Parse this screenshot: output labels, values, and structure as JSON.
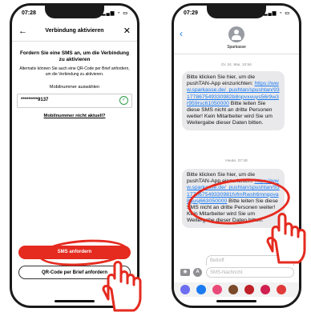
{
  "left": {
    "time": "07:28",
    "header_title": "Verbindung aktivieren",
    "prompt": "Fordern Sie eine SMS an, um die Verbindung zu aktivieren",
    "alt_text": "Alternativ können Sie auch eine QR-Code per Brief anfordern, um die Verbindung zu aktivieren.",
    "field_label": "Mobilnummer auswählen",
    "field_value": "*********9137",
    "link": "Mobilnummer nicht aktuell?",
    "sms_button": "SMS anfordern",
    "qr_button": "QR-Code per Brief anfordern"
  },
  "right": {
    "time": "07:29",
    "contact": "Sparkasse",
    "date1": "Di. 24. Mai, 10:54",
    "msg1_pre": "Bitte klicken Sie hier, um die pushTAN-App einzurichten:",
    "msg1_link": "https://www.sparkasse.de/_pushtan/spushtan/93177867549330982b8npvxvuys56r9w3r959rsc61050000",
    "msg1_post": "Bitte leiten Sie diese SMS nicht an dritte Personen weiter! Kein Mitarbeiter wird Sie um Weitergabe dieser Daten bitten.",
    "date2": "Heute, 07:28",
    "msg2_pre": "Bitte klicken Sie hier, um die pushTAN-App einzurichten:",
    "msg2_link": "https://www.sparkasse.de/_pushtan/spushtan/93177867549330981fvfmRwsh6mnqova8gusj663050000",
    "msg2_post": "Bitte leiten Sie diese SMS nicht an dritte Personen weiter! Kein Mitarbeiter wird Sie um Weitergabe dieser Daten bitten.",
    "betreff_placeholder": "Betreff",
    "input_placeholder": "SMS-Nachricht"
  },
  "colors": {
    "accent_red": "#e52a1f",
    "link_blue": "#1a7bf2",
    "bubble_gray": "#e9e9eb"
  }
}
